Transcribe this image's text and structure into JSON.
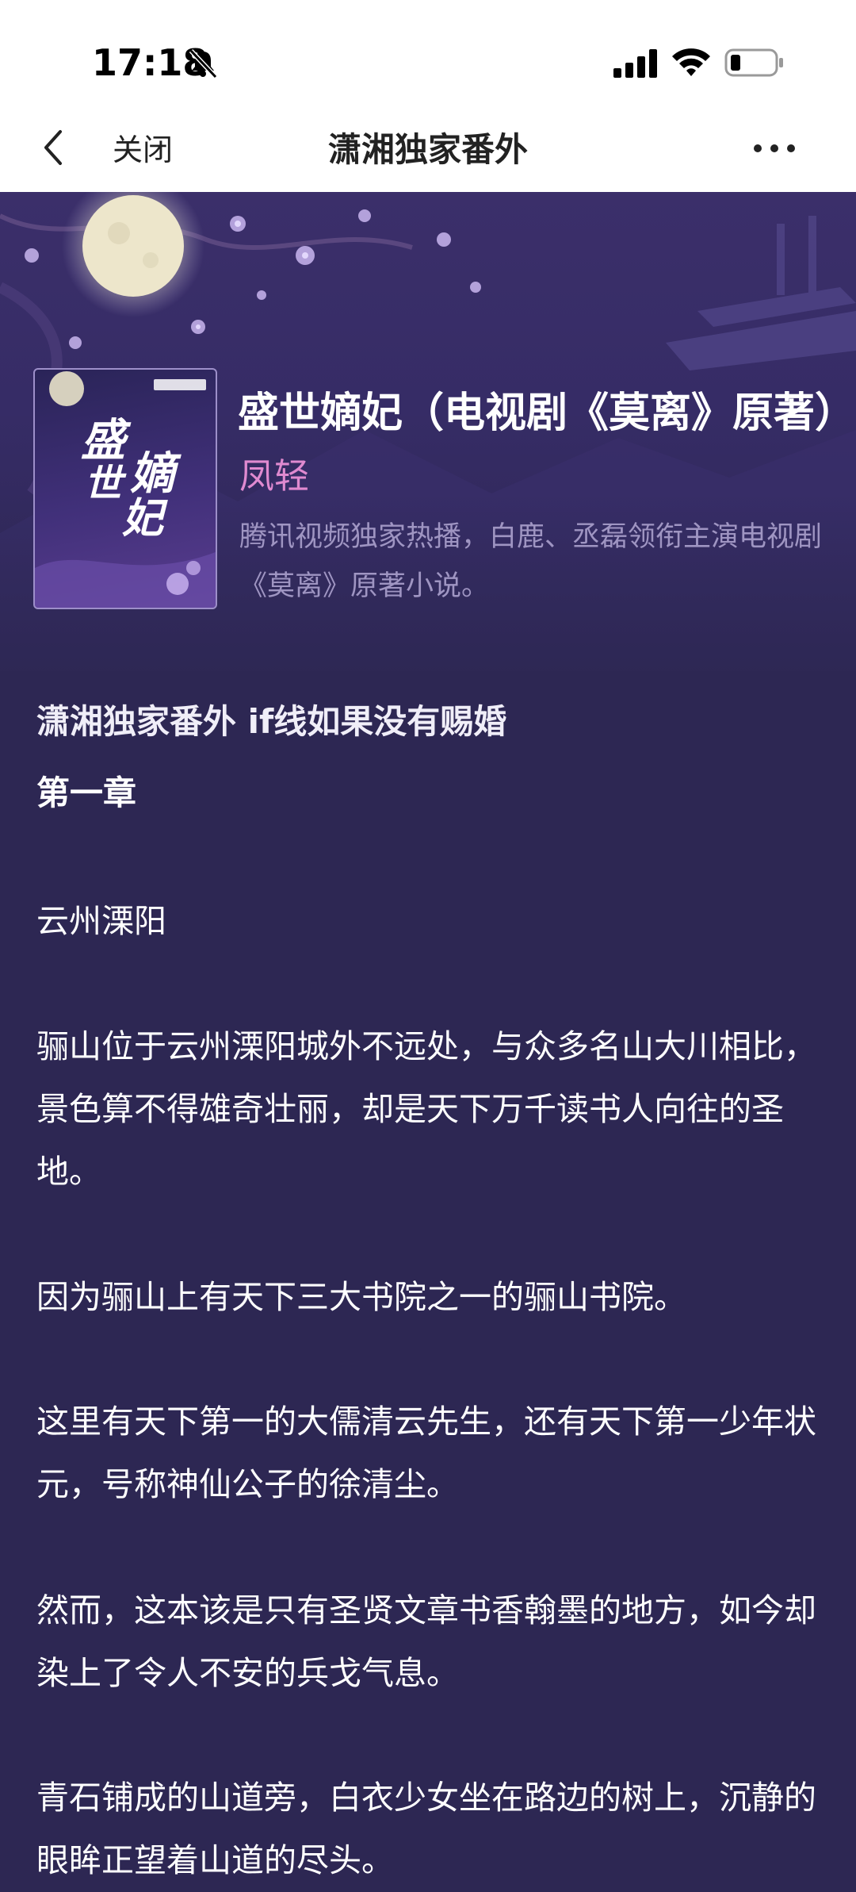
{
  "status_bar": {
    "time": "17:18"
  },
  "nav": {
    "back_icon": "chevron-left-icon",
    "close_label": "关闭",
    "title": "潇湘独家番外",
    "more_icon": "more-dots-icon"
  },
  "book": {
    "title": "盛世嫡妃（电视剧《莫离》原著）",
    "author": "凤轻",
    "description": "腾讯视频独家热播，白鹿、丞磊领衔主演电视剧《莫离》原著小说。",
    "cover_title": "盛世嫡妃"
  },
  "content": {
    "title": "潇湘独家番外 if线如果没有赐婚",
    "chapter": "第一章",
    "paragraphs": [
      "云州溧阳",
      "骊山位于云州溧阳城外不远处，与众多名山大川相比，景色算不得雄奇壮丽，却是天下万千读书人向往的圣地。",
      "因为骊山上有天下三大书院之一的骊山书院。",
      "这里有天下第一的大儒清云先生，还有天下第一少年状元，号称神仙公子的徐清尘。",
      "然而，这本该是只有圣贤文章书香翰墨的地方，如今却染上了令人不安的兵戈气息。",
      "青石铺成的山道旁，白衣少女坐在路边的树上，沉静的眼眸正望着山道的尽头。"
    ]
  },
  "colors": {
    "page_bg": "#2d2753",
    "author": "#e08ad0",
    "desc": "#9f95c2"
  }
}
